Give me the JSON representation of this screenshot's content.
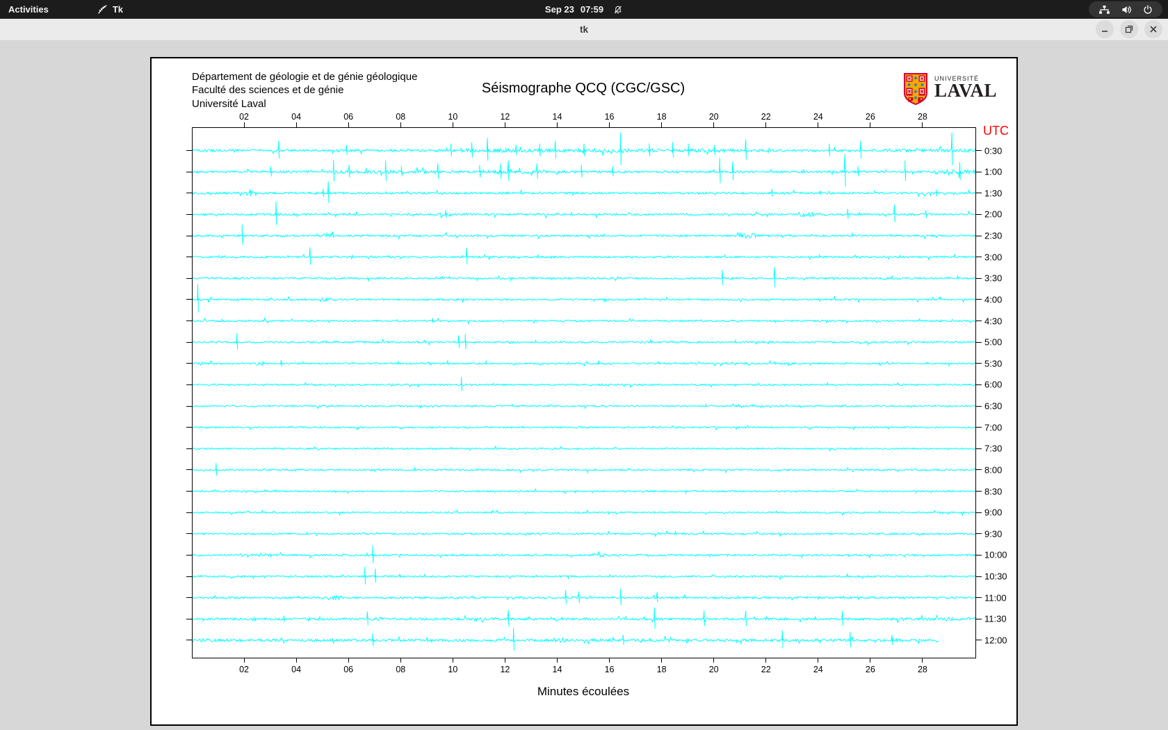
{
  "topbar": {
    "activities": "Activities",
    "app_label": "Tk",
    "clock_date": "Sep 23",
    "clock_time": "07:59",
    "icons": [
      "tk-icon",
      "notifications-disabled-icon",
      "network-icon",
      "volume-icon",
      "power-icon"
    ],
    "bg_color": "#1c1c1c"
  },
  "titlebar": {
    "title": "tk",
    "buttons": [
      "minimize",
      "maximize",
      "close"
    ]
  },
  "seismo": {
    "header_lines": [
      "Département de géologie et de génie géologique",
      "Faculté des sciences et de génie",
      "Université Laval"
    ],
    "title": "Séismographe QCQ (CGC/GSC)",
    "logo": {
      "line1": "UNIVERSITÉ",
      "line2": "LAVAL",
      "gold": "#f2a900",
      "red": "#d50032",
      "blue": "#1f7fd4"
    },
    "utc_label": "UTC",
    "xlabel": "Minutes écoulées",
    "trace_color": "#00ffff",
    "utc_color": "#ff0000"
  },
  "chart_data": {
    "type": "line",
    "title": "Séismographe QCQ (CGC/GSC)",
    "xlabel": "Minutes écoulées",
    "x_range_minutes": [
      0,
      30
    ],
    "x_ticks": [
      "02",
      "04",
      "06",
      "08",
      "10",
      "12",
      "14",
      "16",
      "18",
      "20",
      "22",
      "24",
      "26",
      "28"
    ],
    "row_spacing_px": 30.63,
    "trace_color": "#00ffff",
    "rows": [
      {
        "label": "0:30",
        "act": 1.6,
        "bursts": [
          [
            10.5,
            20.8,
            2.6
          ],
          [
            26.5,
            29.8,
            2.2
          ]
        ],
        "spikes": [
          [
            3.3,
            14
          ],
          [
            5.9,
            8
          ],
          [
            9.9,
            10
          ],
          [
            10.7,
            12
          ],
          [
            11.3,
            18
          ],
          [
            12.4,
            8
          ],
          [
            13.3,
            10
          ],
          [
            13.9,
            14
          ],
          [
            15.0,
            10
          ],
          [
            16.4,
            26
          ],
          [
            17.5,
            10
          ],
          [
            18.4,
            12
          ],
          [
            19.0,
            10
          ],
          [
            20.0,
            8
          ],
          [
            21.2,
            16
          ],
          [
            24.4,
            10
          ],
          [
            25.6,
            14
          ],
          [
            29.1,
            26
          ]
        ]
      },
      {
        "label": "1:00",
        "act": 1.6,
        "bursts": [
          [
            5.3,
            9.0,
            2.6
          ],
          [
            10.5,
            13.5,
            2.4
          ],
          [
            28.8,
            30,
            3.0
          ]
        ],
        "spikes": [
          [
            3.0,
            8
          ],
          [
            5.4,
            17
          ],
          [
            6.0,
            10
          ],
          [
            7.4,
            16
          ],
          [
            8.0,
            8
          ],
          [
            9.4,
            12
          ],
          [
            11.0,
            10
          ],
          [
            11.8,
            12
          ],
          [
            12.1,
            16
          ],
          [
            13.2,
            12
          ],
          [
            14.9,
            10
          ],
          [
            16.1,
            8
          ],
          [
            20.2,
            20
          ],
          [
            20.7,
            15
          ],
          [
            25.0,
            26
          ],
          [
            25.5,
            8
          ],
          [
            27.3,
            16
          ],
          [
            29.4,
            14
          ]
        ]
      },
      {
        "label": "1:30",
        "act": 1.5,
        "bursts": [
          [
            2.0,
            2.5,
            3.2
          ],
          [
            24.0,
            24.4,
            2.8
          ]
        ],
        "spikes": [
          [
            2.2,
            5
          ],
          [
            5.0,
            6
          ],
          [
            5.2,
            17
          ],
          [
            22.2,
            6
          ],
          [
            28.5,
            5
          ]
        ]
      },
      {
        "label": "2:00",
        "act": 1.4,
        "bursts": [
          [
            9.5,
            9.9,
            3.4
          ],
          [
            23.2,
            23.8,
            3.2
          ]
        ],
        "spikes": [
          [
            3.2,
            19
          ],
          [
            9.7,
            6
          ],
          [
            25.1,
            8
          ],
          [
            26.9,
            14
          ],
          [
            28.1,
            6
          ]
        ]
      },
      {
        "label": "2:30",
        "act": 1.4,
        "bursts": [
          [
            5.0,
            5.4,
            3.0
          ],
          [
            21.0,
            21.6,
            3.4
          ]
        ],
        "spikes": [
          [
            1.9,
            16
          ]
        ]
      },
      {
        "label": "3:00",
        "act": 1.3,
        "bursts": [],
        "spikes": [
          [
            4.5,
            14
          ],
          [
            10.5,
            13
          ]
        ]
      },
      {
        "label": "3:30",
        "act": 1.3,
        "bursts": [],
        "spikes": [
          [
            20.3,
            12
          ],
          [
            22.3,
            16
          ]
        ]
      },
      {
        "label": "4:00",
        "act": 1.3,
        "bursts": [
          [
            4.9,
            5.3,
            3.0
          ]
        ],
        "spikes": [
          [
            0.2,
            22
          ]
        ]
      },
      {
        "label": "4:30",
        "act": 1.2,
        "bursts": [],
        "spikes": [
          [
            9.2,
            4
          ]
        ]
      },
      {
        "label": "5:00",
        "act": 1.3,
        "bursts": [],
        "spikes": [
          [
            1.7,
            13
          ],
          [
            10.2,
            10
          ],
          [
            10.45,
            12
          ]
        ]
      },
      {
        "label": "5:30",
        "act": 1.2,
        "bursts": [
          [
            2.4,
            2.7,
            2.8
          ]
        ],
        "spikes": [
          [
            3.4,
            5
          ]
        ]
      },
      {
        "label": "6:00",
        "act": 1.2,
        "bursts": [],
        "spikes": [
          [
            10.3,
            11
          ]
        ]
      },
      {
        "label": "6:30",
        "act": 1.1,
        "bursts": [],
        "spikes": []
      },
      {
        "label": "7:00",
        "act": 1.1,
        "bursts": [],
        "spikes": []
      },
      {
        "label": "7:30",
        "act": 1.1,
        "bursts": [],
        "spikes": []
      },
      {
        "label": "8:00",
        "act": 1.2,
        "bursts": [],
        "spikes": [
          [
            0.9,
            10
          ]
        ]
      },
      {
        "label": "8:30",
        "act": 1.1,
        "bursts": [],
        "spikes": []
      },
      {
        "label": "9:00",
        "act": 1.2,
        "bursts": [],
        "spikes": []
      },
      {
        "label": "9:30",
        "act": 1.2,
        "bursts": [],
        "spikes": []
      },
      {
        "label": "10:00",
        "act": 1.3,
        "bursts": [
          [
            15.3,
            15.8,
            3.2
          ]
        ],
        "spikes": [
          [
            6.9,
            14
          ]
        ]
      },
      {
        "label": "10:30",
        "act": 1.3,
        "bursts": [],
        "spikes": [
          [
            6.6,
            14
          ],
          [
            7.0,
            11
          ]
        ]
      },
      {
        "label": "11:00",
        "act": 1.4,
        "bursts": [
          [
            5.2,
            5.7,
            3.2
          ]
        ],
        "spikes": [
          [
            14.3,
            11
          ],
          [
            14.8,
            9
          ],
          [
            16.4,
            13
          ],
          [
            17.8,
            8
          ]
        ]
      },
      {
        "label": "11:30",
        "act": 1.6,
        "bursts": [
          [
            6.8,
            7.3,
            2.6
          ],
          [
            27.0,
            30,
            2.4
          ]
        ],
        "spikes": [
          [
            3.5,
            5
          ],
          [
            6.7,
            11
          ],
          [
            12.1,
            13
          ],
          [
            17.7,
            17
          ],
          [
            19.6,
            12
          ],
          [
            21.2,
            12
          ],
          [
            24.9,
            12
          ]
        ]
      },
      {
        "label": "12:00",
        "act": 1.9,
        "end": 28.6,
        "bursts": [
          [
            0,
            0.6,
            2.6
          ],
          [
            13.8,
            14.3,
            3.4
          ]
        ],
        "spikes": [
          [
            6.9,
            10
          ],
          [
            12.3,
            18
          ],
          [
            16.5,
            8
          ],
          [
            22.6,
            14
          ],
          [
            25.2,
            12
          ],
          [
            26.8,
            8
          ]
        ]
      }
    ]
  }
}
